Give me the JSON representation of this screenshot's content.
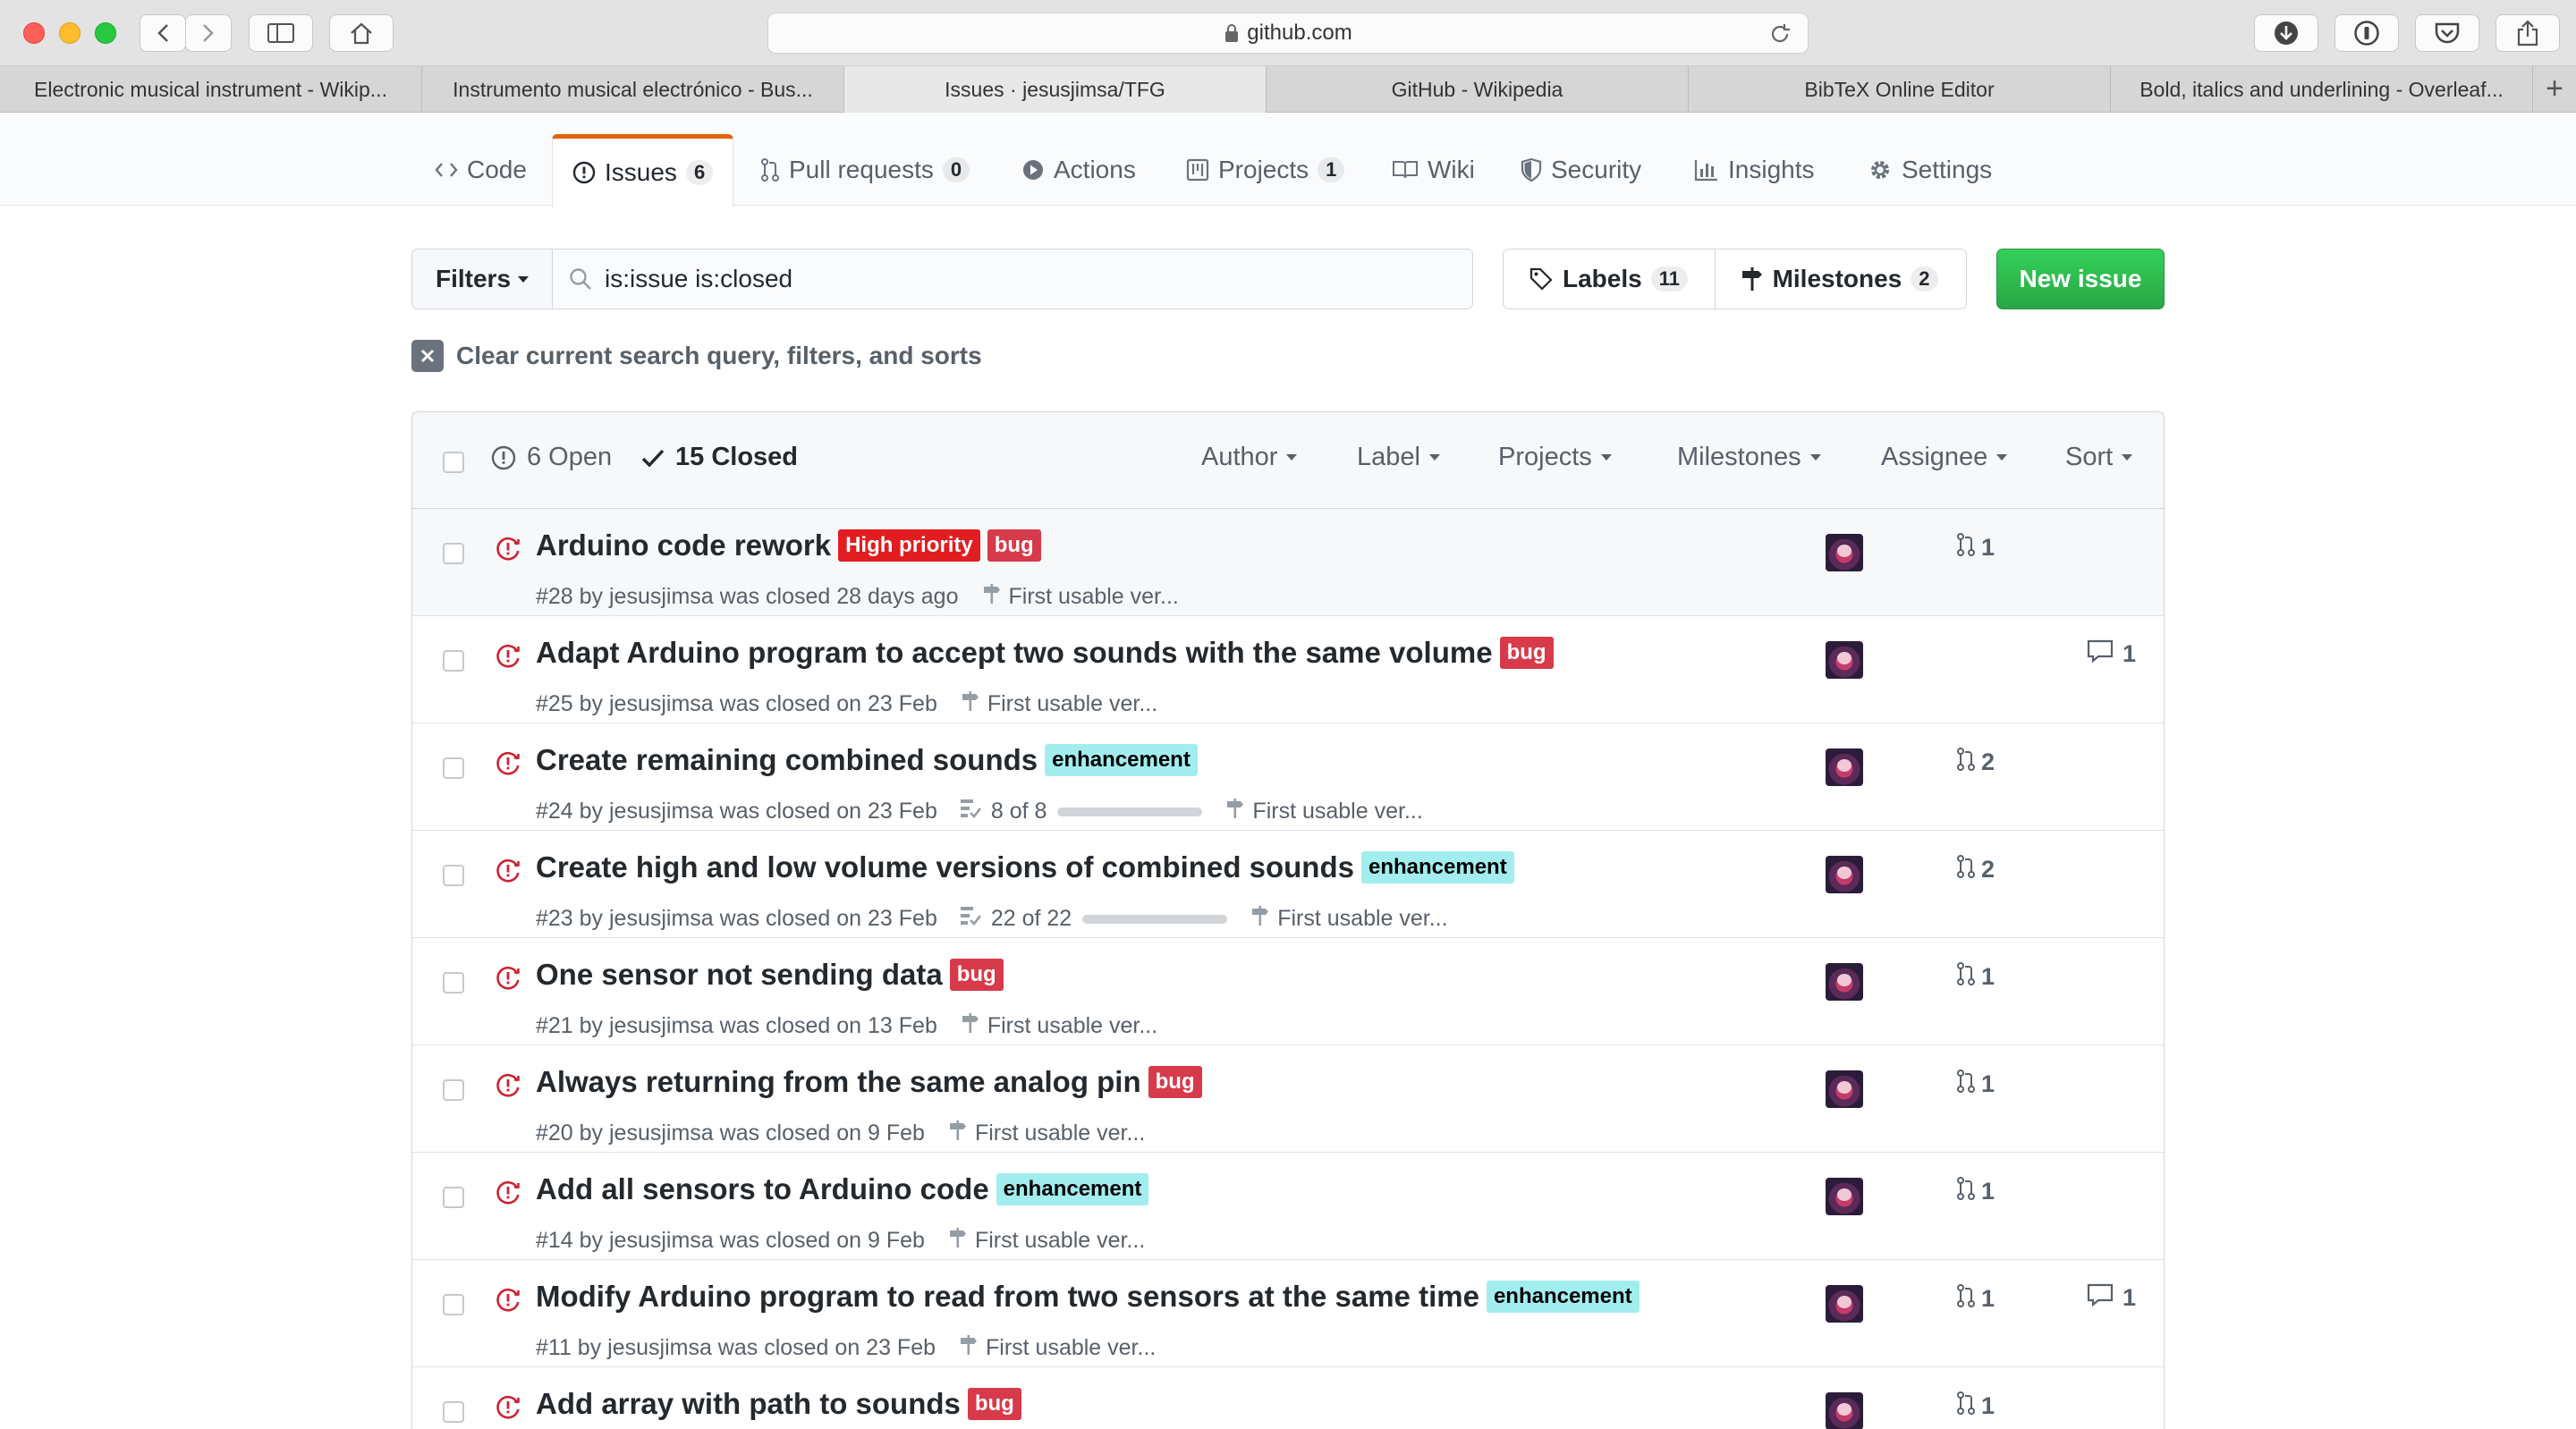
{
  "browser": {
    "url": "github.com",
    "tabs": [
      {
        "label": "Electronic musical instrument - Wikip...",
        "active": false
      },
      {
        "label": "Instrumento musical electrónico - Bus...",
        "active": false
      },
      {
        "label": "Issues · jesusjimsa/TFG",
        "active": true
      },
      {
        "label": "GitHub - Wikipedia",
        "active": false
      },
      {
        "label": "BibTeX Online Editor",
        "active": false
      },
      {
        "label": "Bold, italics and underlining - Overleaf...",
        "active": false
      }
    ],
    "new_tab": "+"
  },
  "repo_nav": {
    "code": "Code",
    "issues": "Issues",
    "issues_count": "6",
    "pull_requests": "Pull requests",
    "pull_requests_count": "0",
    "actions": "Actions",
    "projects": "Projects",
    "projects_count": "1",
    "wiki": "Wiki",
    "security": "Security",
    "insights": "Insights",
    "settings": "Settings"
  },
  "subnav": {
    "filters": "Filters",
    "search_value": "is:issue is:closed",
    "labels": "Labels",
    "labels_count": "11",
    "milestones": "Milestones",
    "milestones_count": "2",
    "new_issue": "New issue",
    "clear": "Clear current search query, filters, and sorts"
  },
  "list_header": {
    "open": "6 Open",
    "closed": "15 Closed",
    "author": "Author",
    "label": "Label",
    "projects": "Projects",
    "milestones": "Milestones",
    "assignee": "Assignee",
    "sort": "Sort"
  },
  "colors": {
    "bug": "#d73a4a",
    "high_priority": "#e11d21",
    "enhancement": "#a2eeef",
    "closed_icon": "#cb2431",
    "new_issue": "#28a745",
    "selected_tab": "#e36209"
  },
  "issues": [
    {
      "title": "Arduino code rework",
      "labels": [
        {
          "name": "High priority",
          "bg": "#e11d21",
          "fg": "#ffffff"
        },
        {
          "name": "bug",
          "bg": "#d73a4a",
          "fg": "#ffffff"
        }
      ],
      "meta": "#28 by jesusjimsa was closed 28 days ago",
      "tasks": "",
      "milestone": "First usable ver...",
      "prs": "1",
      "comments": ""
    },
    {
      "title": "Adapt Arduino program to accept two sounds with the same volume",
      "labels": [
        {
          "name": "bug",
          "bg": "#d73a4a",
          "fg": "#ffffff"
        }
      ],
      "meta": "#25 by jesusjimsa was closed on 23 Feb",
      "tasks": "",
      "milestone": "First usable ver...",
      "prs": "",
      "comments": "1"
    },
    {
      "title": "Create remaining combined sounds",
      "labels": [
        {
          "name": "enhancement",
          "bg": "#a2eeef",
          "fg": "#000000"
        }
      ],
      "meta": "#24 by jesusjimsa was closed on 23 Feb",
      "tasks": "8 of 8",
      "task_progress": 1.0,
      "milestone": "First usable ver...",
      "prs": "2",
      "comments": ""
    },
    {
      "title": "Create high and low volume versions of combined sounds",
      "labels": [
        {
          "name": "enhancement",
          "bg": "#a2eeef",
          "fg": "#000000"
        }
      ],
      "meta": "#23 by jesusjimsa was closed on 23 Feb",
      "tasks": "22 of 22",
      "task_progress": 1.0,
      "milestone": "First usable ver...",
      "prs": "2",
      "comments": ""
    },
    {
      "title": "One sensor not sending data",
      "labels": [
        {
          "name": "bug",
          "bg": "#d73a4a",
          "fg": "#ffffff"
        }
      ],
      "meta": "#21 by jesusjimsa was closed on 13 Feb",
      "tasks": "",
      "milestone": "First usable ver...",
      "prs": "1",
      "comments": ""
    },
    {
      "title": "Always returning from the same analog pin",
      "labels": [
        {
          "name": "bug",
          "bg": "#d73a4a",
          "fg": "#ffffff"
        }
      ],
      "meta": "#20 by jesusjimsa was closed on 9 Feb",
      "tasks": "",
      "milestone": "First usable ver...",
      "prs": "1",
      "comments": ""
    },
    {
      "title": "Add all sensors to Arduino code",
      "labels": [
        {
          "name": "enhancement",
          "bg": "#a2eeef",
          "fg": "#000000"
        }
      ],
      "meta": "#14 by jesusjimsa was closed on 9 Feb",
      "tasks": "",
      "milestone": "First usable ver...",
      "prs": "1",
      "comments": ""
    },
    {
      "title": "Modify Arduino program to read from two sensors at the same time",
      "labels": [
        {
          "name": "enhancement",
          "bg": "#a2eeef",
          "fg": "#000000"
        }
      ],
      "meta": "#11 by jesusjimsa was closed on 23 Feb",
      "tasks": "",
      "milestone": "First usable ver...",
      "prs": "1",
      "comments": "1"
    },
    {
      "title": "Add array with path to sounds",
      "labels": [
        {
          "name": "bug",
          "bg": "#d73a4a",
          "fg": "#ffffff"
        }
      ],
      "meta": "",
      "tasks": "",
      "milestone": "",
      "prs": "1",
      "comments": ""
    }
  ]
}
